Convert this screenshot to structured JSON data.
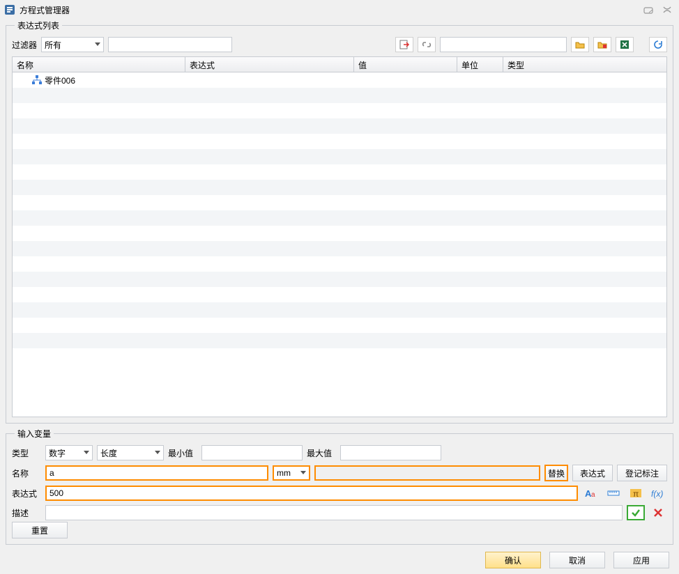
{
  "window": {
    "title": "方程式管理器"
  },
  "list_section": {
    "legend": "表达式列表",
    "filter_label": "过滤器",
    "filter_value": "所有",
    "columns": {
      "name": "名称",
      "expr": "表达式",
      "value": "值",
      "unit": "单位",
      "type": "类型"
    },
    "rows": [
      {
        "name": "零件006"
      }
    ]
  },
  "input_section": {
    "legend": "输入变量",
    "type_label": "类型",
    "type_value": "数字",
    "subtype_value": "长度",
    "min_label": "最小值",
    "max_label": "最大值",
    "name_label": "名称",
    "name_value": "a",
    "unit_value": "mm",
    "replace_label": "替换",
    "expr_btn_label": "表达式",
    "register_label": "登记标注",
    "expr_label": "表达式",
    "expr_value": "500",
    "desc_label": "描述",
    "reset_label": "重置"
  },
  "dialog": {
    "ok": "确认",
    "cancel": "取消",
    "apply": "应用"
  },
  "icons": {
    "app": "app-icon",
    "help": "help-icon",
    "close": "close-icon",
    "sheet_in": "sheet-arrow-icon",
    "link": "link-icon",
    "folder1": "folder-open-icon",
    "folder2": "folder-open-red-icon",
    "excel": "excel-icon",
    "refresh": "refresh-icon",
    "tree": "tree-icon",
    "font": "font-icon",
    "ruler": "ruler-icon",
    "pi": "pi-icon",
    "fx": "fx-icon",
    "check": "check-icon",
    "cross": "cross-icon",
    "caret": "caret-down-icon"
  }
}
